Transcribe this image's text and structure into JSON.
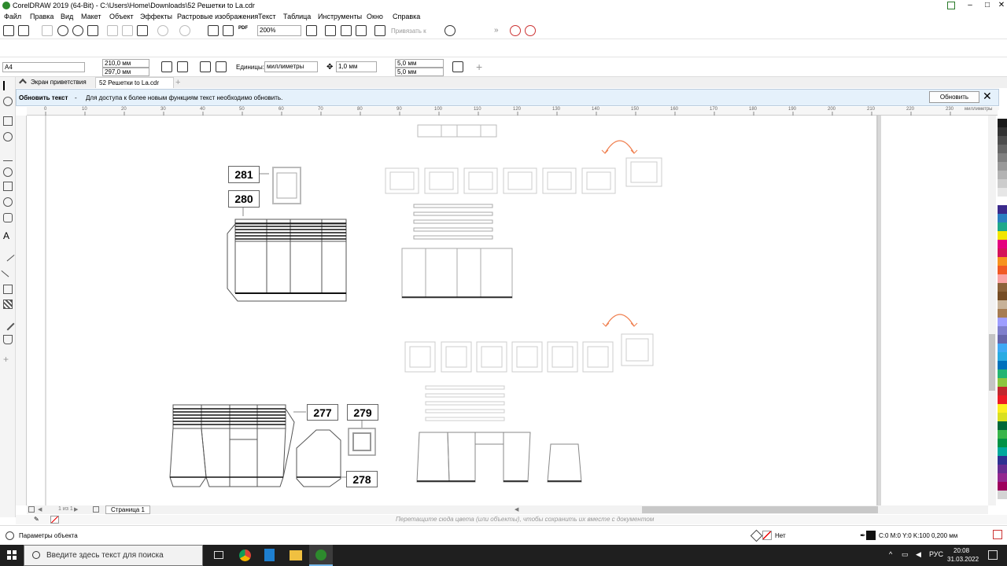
{
  "titlebar": {
    "title": "CorelDRAW 2019 (64-Bit) - C:\\Users\\Home\\Downloads\\52 Решетки to La.cdr",
    "minimize": "–",
    "restore": "□",
    "close": "✕"
  },
  "menu": [
    "Файл",
    "Правка",
    "Вид",
    "Макет",
    "Объект",
    "Эффекты",
    "Растровые изображения",
    "Текст",
    "Таблица",
    "Инструменты",
    "Окно",
    "Справка"
  ],
  "toolbar": {
    "zoom": "200%",
    "snap": "Привязать к",
    "pdf": "PDF"
  },
  "propbar": {
    "page_size": "A4",
    "width": "210,0 мм",
    "height": "297,0 мм",
    "units_label": "Единицы:",
    "units": "миллиметры",
    "nudge": "1,0 мм",
    "dup_x": "5,0 мм",
    "dup_y": "5,0 мм"
  },
  "tabs": {
    "welcome": "Экран приветствия",
    "doc": "52 Решетки to La.cdr",
    "add": "+"
  },
  "infobar": {
    "title": "Обновить текст",
    "dash": "-",
    "message": "Для доступа к более новым функциям текст необходимо обновить.",
    "button": "Обновить",
    "close": "✕"
  },
  "ruler": {
    "ticks": [
      "0",
      "10",
      "20",
      "30",
      "40",
      "50",
      "60",
      "70",
      "80",
      "90",
      "100",
      "110",
      "120",
      "130",
      "140",
      "150",
      "160",
      "170",
      "180",
      "190",
      "200",
      "210",
      "220",
      "230"
    ],
    "unit": "миллиметры"
  },
  "labels": {
    "n281": "281",
    "n280": "280",
    "n277": "277",
    "n279": "279",
    "n278": "278"
  },
  "pagenav": {
    "of": "1 из 1",
    "page": "Страница 1"
  },
  "docpalette": {
    "hint": "Перетащите сюда цвета (или объекты), чтобы сохранить их вместе с документом"
  },
  "status": {
    "props": "Параметры объекта",
    "fill": "Нет",
    "outline": "C:0 M:0 Y:0 K:100  0,200 мм"
  },
  "taskbar": {
    "search": "Введите здесь текст для поиска",
    "lang": "РУС",
    "time": "20:08",
    "date": "31.03.2022"
  },
  "colors": {
    "accent": "#0078d7",
    "infobar": "#e5f1fb",
    "arrow": "#f08050"
  },
  "palette": [
    "#ffffff",
    "#1a1a1a",
    "#333333",
    "#4d4d4d",
    "#666666",
    "#808080",
    "#999999",
    "#b3b3b3",
    "#cccccc",
    "#e6e6e6",
    "#ffffff",
    "#3b2a8c",
    "#2a7fc1",
    "#1fa88a",
    "#f2e600",
    "#e5007e",
    "#d4145a",
    "#f7931e",
    "#f15a24",
    "#f9a3a3",
    "#8c6239",
    "#754c24",
    "#c7b299",
    "#a67c52",
    "#9e9eff",
    "#7f7fcc",
    "#6666aa",
    "#3fa9f5",
    "#29abe2",
    "#0071bc",
    "#22b573",
    "#8cc63f",
    "#c1272d",
    "#ed1c24",
    "#fcee21",
    "#d9e021",
    "#006837",
    "#39b54a",
    "#009245",
    "#00a99d",
    "#2e3192",
    "#662d91",
    "#93278f",
    "#9e005d",
    "#d4d4d4"
  ]
}
